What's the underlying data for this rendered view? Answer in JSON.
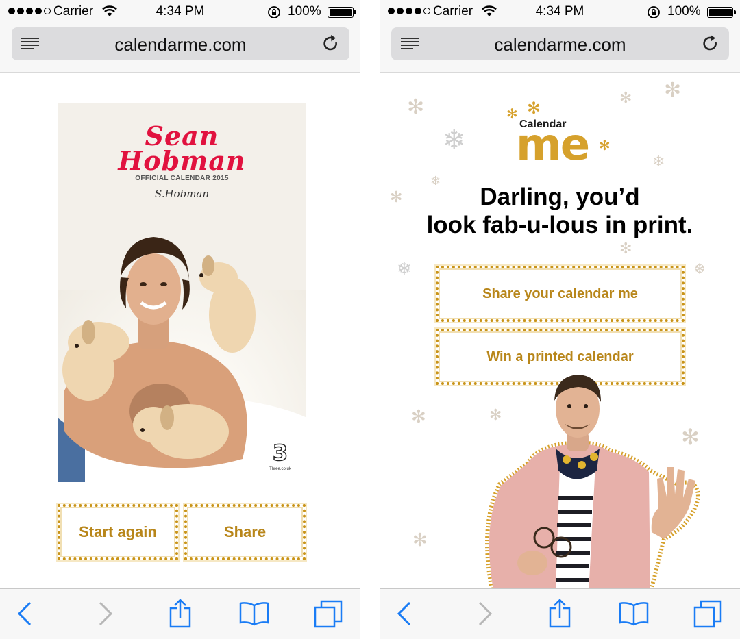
{
  "status_bar": {
    "carrier": "Carrier",
    "time": "4:34 PM",
    "battery": "100%"
  },
  "browser": {
    "url": "calendarme.com"
  },
  "left_page": {
    "cover": {
      "title_line1": "Sean",
      "title_line2": "Hobman",
      "subtitle": "OFFICIAL CALENDAR 2015",
      "signature": "S.Hobman",
      "brand_logo": "3",
      "brand_url": "Three.co.uk"
    },
    "buttons": {
      "start_again": "Start again",
      "share": "Share"
    }
  },
  "right_page": {
    "logo": {
      "calendar": "Calendar",
      "me": "me"
    },
    "headline_line1": "Darling, you’d",
    "headline_line2": "look fab-u-lous in print.",
    "buttons": {
      "share_calendar": "Share your calendar me",
      "win_calendar": "Win a printed calendar"
    }
  },
  "colors": {
    "gold": "#c99419",
    "cover_title_red": "#e1123f",
    "ios_blue": "#1a7cf5",
    "bar_bg": "#f7f7f7"
  }
}
